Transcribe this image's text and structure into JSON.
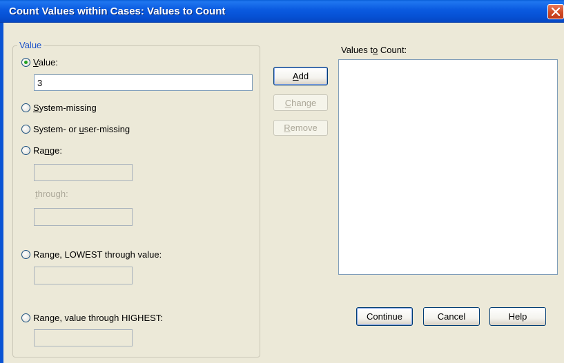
{
  "window": {
    "title": "Count Values within Cases: Values to Count"
  },
  "value_group": {
    "legend": "Value",
    "options": {
      "value": {
        "pre": "",
        "mnemonic": "V",
        "post": "alue:",
        "checked": true
      },
      "system_missing": {
        "pre": "",
        "mnemonic": "S",
        "post": "ystem-missing",
        "checked": false
      },
      "system_or_user_missing": {
        "pre": "System- or ",
        "mnemonic": "u",
        "post": "ser-missing",
        "checked": false
      },
      "range": {
        "pre": "Ra",
        "mnemonic": "n",
        "post": "ge:",
        "checked": false
      },
      "range_lowest": {
        "pre": "Range, LOWEST through value:",
        "mnemonic": "",
        "post": "",
        "checked": false
      },
      "range_highest": {
        "pre": "Range",
        "mnemonic": ",",
        "post": " value through HIGHEST:",
        "checked": false
      }
    },
    "value_input": "3",
    "range_from_input": "",
    "through_label": {
      "mnemonic": "t",
      "post": "hrough:"
    },
    "range_to_input": "",
    "lowest_input": "",
    "highest_input": ""
  },
  "actions": {
    "add": {
      "mnemonic": "A",
      "post": "dd"
    },
    "change": {
      "mnemonic": "C",
      "post": "hange"
    },
    "remove": {
      "mnemonic": "R",
      "post": "emove"
    }
  },
  "values_list": {
    "label": {
      "pre": "Values t",
      "mnemonic": "o",
      "post": " Count:"
    },
    "items": []
  },
  "footer": {
    "continue": "Continue",
    "cancel": "Cancel",
    "help": "Help"
  },
  "colors": {
    "titlebar": "#0a5ae0",
    "dialog_bg": "#ece9d8",
    "legend_text": "#1a51c8",
    "radio_dot": "#21a121",
    "close_button": "#d04a24"
  }
}
